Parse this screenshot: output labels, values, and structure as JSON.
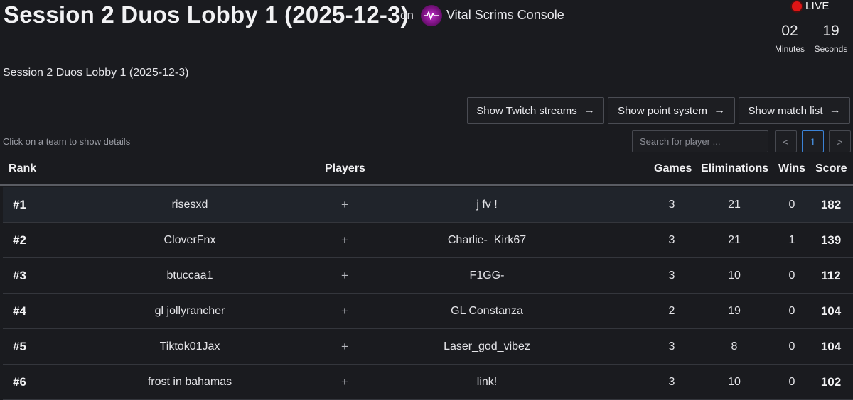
{
  "header": {
    "title": "Session 2 Duos Lobby 1 (2025-12-3)",
    "on_label": "on",
    "console_name": "Vital Scrims Console",
    "live_label": "LIVE",
    "timer": {
      "minutes_value": "02",
      "minutes_label": "Minutes",
      "seconds_value": "19",
      "seconds_label": "Seconds"
    }
  },
  "subtitle": "Session 2 Duos Lobby 1 (2025-12-3)",
  "buttons": {
    "twitch": "Show Twitch streams",
    "points": "Show point system",
    "matches": "Show match list"
  },
  "hint": "Click on a team to show details",
  "search": {
    "placeholder": "Search for player ..."
  },
  "pager": {
    "prev": "<",
    "page": "1",
    "next": ">"
  },
  "table": {
    "headers": {
      "rank": "Rank",
      "players": "Players",
      "games": "Games",
      "eliminations": "Eliminations",
      "wins": "Wins",
      "score": "Score"
    },
    "rows": [
      {
        "rank": "#1",
        "player1": "risesxd",
        "sep": "+",
        "player2": "j fv !",
        "games": "3",
        "eliminations": "21",
        "wins": "0",
        "score": "182"
      },
      {
        "rank": "#2",
        "player1": "CloverFnx",
        "sep": "+",
        "player2": "Charlie-_Kirk67",
        "games": "3",
        "eliminations": "21",
        "wins": "1",
        "score": "139"
      },
      {
        "rank": "#3",
        "player1": "btuccaa1",
        "sep": "+",
        "player2": "F1GG-",
        "games": "3",
        "eliminations": "10",
        "wins": "0",
        "score": "112"
      },
      {
        "rank": "#4",
        "player1": "gl jollyrancher",
        "sep": "+",
        "player2": "GL Constanza",
        "games": "2",
        "eliminations": "19",
        "wins": "0",
        "score": "104"
      },
      {
        "rank": "#5",
        "player1": "Tiktok01Jax",
        "sep": "+",
        "player2": "Laser_god_vibez",
        "games": "3",
        "eliminations": "8",
        "wins": "0",
        "score": "104"
      },
      {
        "rank": "#6",
        "player1": "frost in bahamas",
        "sep": "+",
        "player2": "link!",
        "games": "3",
        "eliminations": "10",
        "wins": "0",
        "score": "102"
      }
    ]
  },
  "colors": {
    "background": "#1a1b1f",
    "live_red": "#e01515",
    "active_page_blue": "#3b82d6",
    "logo_magenta": "#c02cc8"
  }
}
